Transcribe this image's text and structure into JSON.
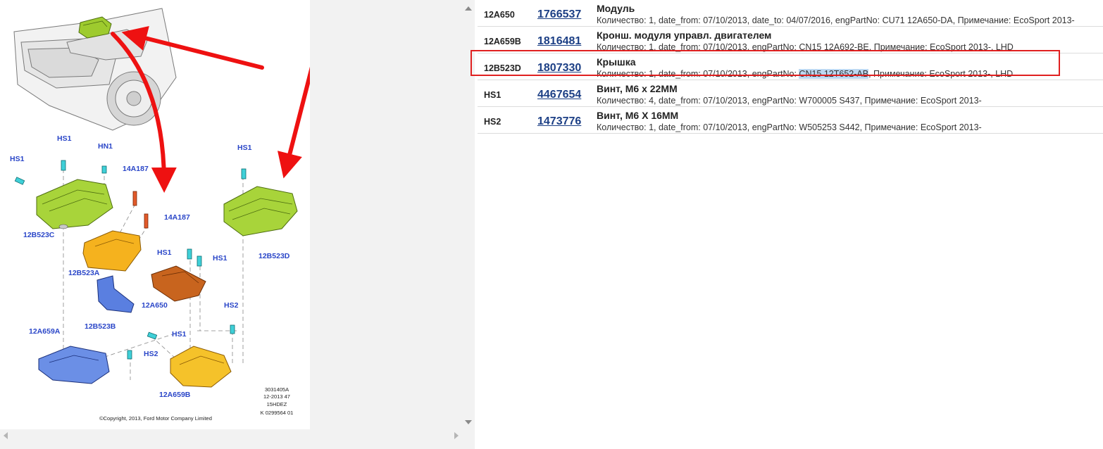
{
  "diagram": {
    "labels": {
      "hs1_a": "HS1",
      "hs1_b": "HS1",
      "hn1": "HN1",
      "l_14a187_a": "14A187",
      "l_14a187_b": "14A187",
      "hs1_c": "HS1",
      "hs1_d": "HS1",
      "hs1_e": "HS1",
      "hs1_f": "HS1",
      "hs2_a": "HS2",
      "hs2_b": "HS2",
      "l_12b523c": "12B523C",
      "l_12b523a": "12B523A",
      "l_12b523b": "12B523B",
      "l_12a650": "12A650",
      "l_12a659a": "12A659A",
      "l_12a659b": "12A659B",
      "l_12b523d": "12B523D"
    },
    "ref": [
      "3031405A",
      "12-2013 47",
      "15HDEZ",
      "K 0299564 01"
    ],
    "copyright": "©Copyright, 2013, Ford Motor Company Limited"
  },
  "parts": [
    {
      "code": "12A650",
      "number": "1766537",
      "name": "Модуль",
      "details": "Количество: 1, date_from: 07/10/2013, date_to: 04/07/2016, engPartNo: CU71 12A650-DA, Примечание: EcoSport 2013-"
    },
    {
      "code": "12A659B",
      "number": "1816481",
      "name": "Кронш. модуля управл. двигателем",
      "details": "Количество: 1, date_from: 07/10/2013, engPartNo: CN15 12A692-BE, Примечание: EcoSport 2013-, LHD"
    },
    {
      "code": "12B523D",
      "number": "1807330",
      "name": "Крышка",
      "details_before": "Количество: 1, date_from: 07/10/2013, engPartNo: ",
      "details_highlight": "CN15 12T652-AB",
      "details_after": ", Примечание: EcoSport 2013-, LHD"
    },
    {
      "code": "HS1",
      "number": "4467654",
      "name": "Винт, М6 х 22ММ",
      "details": "Количество: 4, date_from: 07/10/2013, engPartNo: W700005 S437, Примечание: EcoSport 2013-"
    },
    {
      "code": "HS2",
      "number": "1473776",
      "name": "Винт, М6 Х 16ММ",
      "details": "Количество: 1, date_from: 07/10/2013, engPartNo: W505253 S442, Примечание: EcoSport 2013-"
    }
  ],
  "colors": {
    "highlight_border": "#e02020",
    "selection": "#bcd8f2",
    "link": "#1c3f85",
    "label_blue": "#2a46c8",
    "arrow_red": "#ee1111"
  }
}
